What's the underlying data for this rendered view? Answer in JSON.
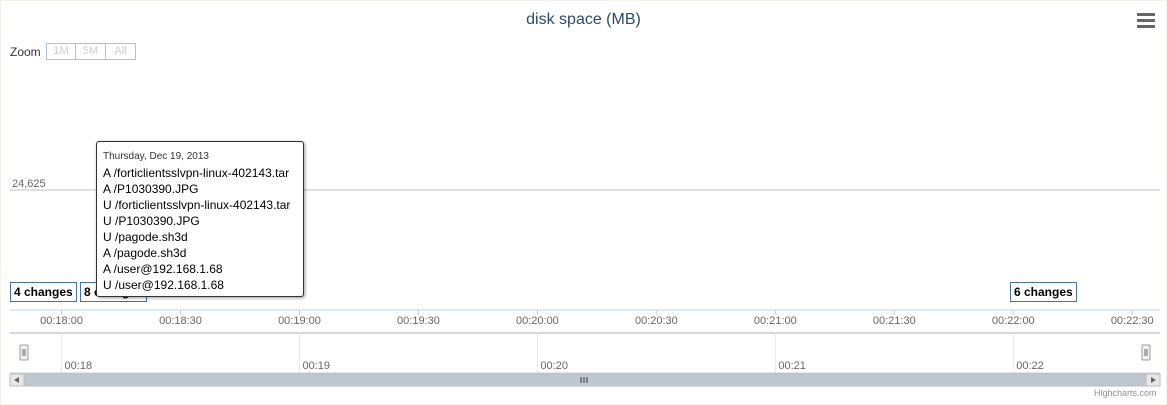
{
  "chart_data": {
    "type": "line",
    "title": "disk space (MB)",
    "y_ticks": [
      "24,625"
    ],
    "x_ticks": [
      "00:18:00",
      "00:18:30",
      "00:19:00",
      "00:19:30",
      "00:20:00",
      "00:20:30",
      "00:21:00",
      "00:21:30",
      "00:22:00",
      "00:22:30"
    ],
    "xlim": [
      "00:17:47",
      "00:22:37"
    ],
    "flags": [
      {
        "time": "00:17:47",
        "label": "4 changes"
      },
      {
        "time": "00:18:05",
        "label": "8 changes"
      },
      {
        "time": "00:22:00",
        "label": "6 changes"
      }
    ],
    "navigator": {
      "ticks": [
        "00:18",
        "00:19",
        "00:20",
        "00:21",
        "00:22"
      ]
    },
    "grid": true,
    "legend": "none"
  },
  "zoom": {
    "label": "Zoom",
    "buttons": [
      "1M",
      "5M",
      "All"
    ]
  },
  "tooltip": {
    "date": "Thursday, Dec 19, 2013",
    "lines": [
      "A /forticlientsslvpn-linux-402143.tar",
      "A /P1030390.JPG",
      "U /forticlientsslvpn-linux-402143.tar",
      "U /P1030390.JPG",
      "U /pagode.sh3d",
      "A /pagode.sh3d",
      "A /user@192.168.1.68",
      "U /user@192.168.1.68"
    ]
  },
  "credits": "Highcharts.com",
  "colors": {
    "title": "#274b6d",
    "flag_border": "#4572a7",
    "grid": "#c0c0c0",
    "navigator_bg": "#f2f2f2"
  },
  "icons": {
    "menu": "hamburger-menu-icon",
    "scroll_left": "arrow-left-icon",
    "scroll_right": "arrow-right-icon",
    "grip": "grip-icon"
  }
}
